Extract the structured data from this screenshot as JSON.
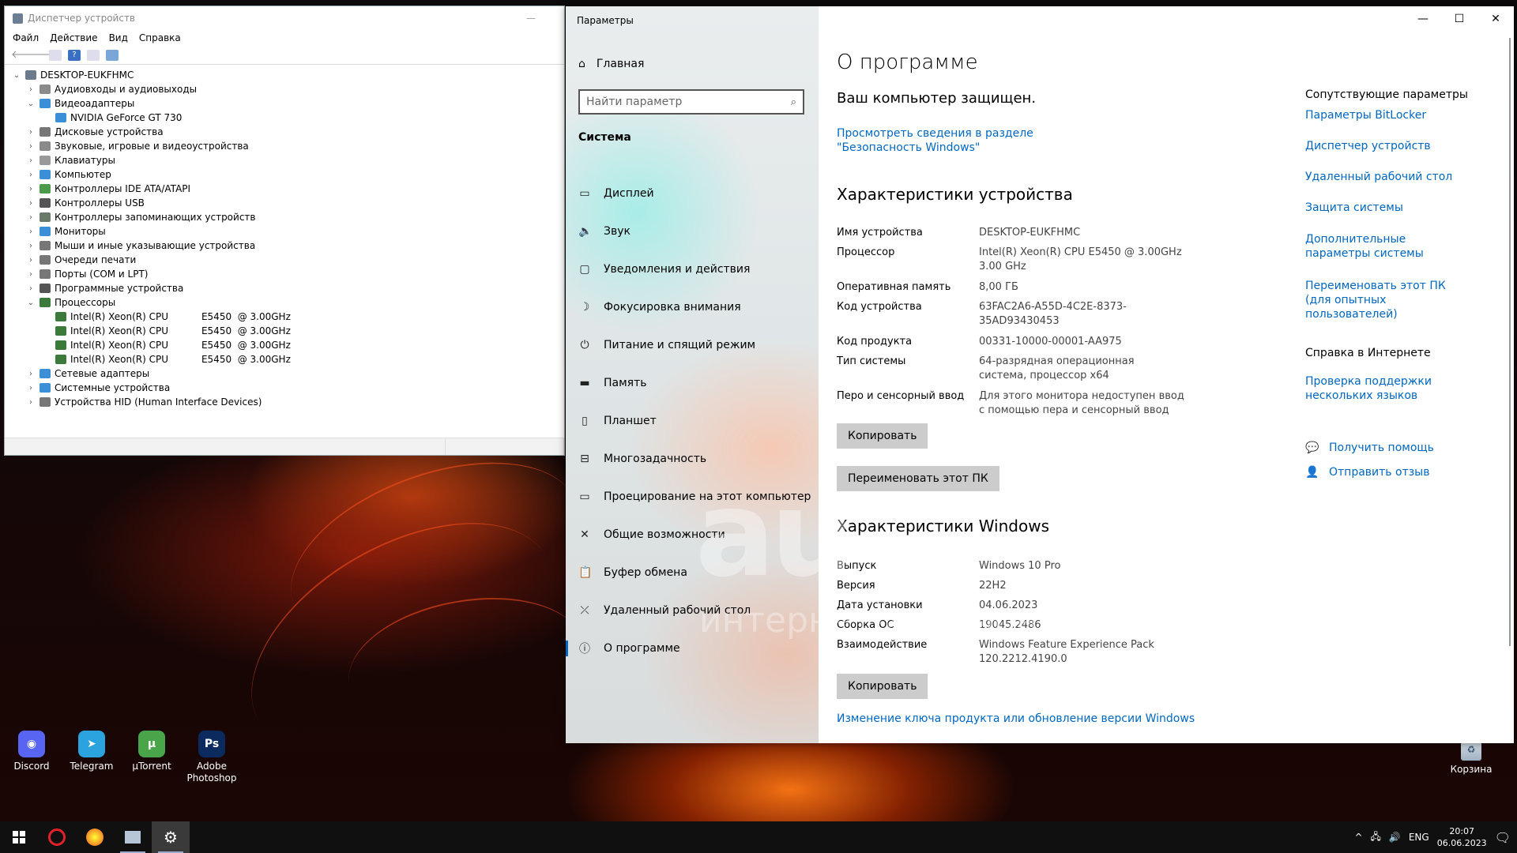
{
  "device_manager": {
    "title": "Диспетчер устройств",
    "menu": [
      "Файл",
      "Действие",
      "Вид",
      "Справка"
    ],
    "tree": [
      {
        "level": 0,
        "exp": "v",
        "label": "DESKTOP-EUKFHMC",
        "color": "#6b7b8c"
      },
      {
        "level": 1,
        "exp": ">",
        "label": "Аудиовходы и аудиовыходы",
        "color": "#8a8a8a"
      },
      {
        "level": 1,
        "exp": "v",
        "label": "Видеоадаптеры",
        "color": "#3b8fd6"
      },
      {
        "level": 2,
        "exp": "",
        "label": "NVIDIA GeForce GT 730",
        "color": "#3b8fd6"
      },
      {
        "level": 1,
        "exp": ">",
        "label": "Дисковые устройства",
        "color": "#777"
      },
      {
        "level": 1,
        "exp": ">",
        "label": "Звуковые, игровые и видеоустройства",
        "color": "#8a8a8a"
      },
      {
        "level": 1,
        "exp": ">",
        "label": "Клавиатуры",
        "color": "#999"
      },
      {
        "level": 1,
        "exp": ">",
        "label": "Компьютер",
        "color": "#3b8fd6"
      },
      {
        "level": 1,
        "exp": ">",
        "label": "Контроллеры IDE ATA/ATAPI",
        "color": "#4a9a4a"
      },
      {
        "level": 1,
        "exp": ">",
        "label": "Контроллеры USB",
        "color": "#555"
      },
      {
        "level": 1,
        "exp": ">",
        "label": "Контроллеры запоминающих устройств",
        "color": "#6a7a6a"
      },
      {
        "level": 1,
        "exp": ">",
        "label": "Мониторы",
        "color": "#3b8fd6"
      },
      {
        "level": 1,
        "exp": ">",
        "label": "Мыши и иные указывающие устройства",
        "color": "#777"
      },
      {
        "level": 1,
        "exp": ">",
        "label": "Очереди печати",
        "color": "#777"
      },
      {
        "level": 1,
        "exp": ">",
        "label": "Порты (COM и LPT)",
        "color": "#777"
      },
      {
        "level": 1,
        "exp": ">",
        "label": "Программные устройства",
        "color": "#555"
      },
      {
        "level": 1,
        "exp": "v",
        "label": "Процессоры",
        "color": "#3c7a3c"
      },
      {
        "level": 2,
        "exp": "",
        "label": "Intel(R) Xeon(R) CPU           E5450  @ 3.00GHz",
        "color": "#3c7a3c"
      },
      {
        "level": 2,
        "exp": "",
        "label": "Intel(R) Xeon(R) CPU           E5450  @ 3.00GHz",
        "color": "#3c7a3c"
      },
      {
        "level": 2,
        "exp": "",
        "label": "Intel(R) Xeon(R) CPU           E5450  @ 3.00GHz",
        "color": "#3c7a3c"
      },
      {
        "level": 2,
        "exp": "",
        "label": "Intel(R) Xeon(R) CPU           E5450  @ 3.00GHz",
        "color": "#3c7a3c"
      },
      {
        "level": 1,
        "exp": ">",
        "label": "Сетевые адаптеры",
        "color": "#3b8fd6"
      },
      {
        "level": 1,
        "exp": ">",
        "label": "Системные устройства",
        "color": "#3b8fd6"
      },
      {
        "level": 1,
        "exp": ">",
        "label": "Устройства HID (Human Interface Devices)",
        "color": "#777"
      }
    ]
  },
  "settings": {
    "window_title": "Параметры",
    "home_label": "Главная",
    "search_placeholder": "Найти параметр",
    "section": "Система",
    "nav": [
      {
        "icon": "▭",
        "label": "Дисплей",
        "name": "display"
      },
      {
        "icon": "🔈",
        "label": "Звук",
        "name": "sound"
      },
      {
        "icon": "▢",
        "label": "Уведомления и действия",
        "name": "notifications"
      },
      {
        "icon": "☽",
        "label": "Фокусировка внимания",
        "name": "focus"
      },
      {
        "icon": "⏻",
        "label": "Питание и спящий режим",
        "name": "power"
      },
      {
        "icon": "▬",
        "label": "Память",
        "name": "storage"
      },
      {
        "icon": "▯",
        "label": "Планшет",
        "name": "tablet"
      },
      {
        "icon": "⊟",
        "label": "Многозадачность",
        "name": "multitasking"
      },
      {
        "icon": "▭",
        "label": "Проецирование на этот компьютер",
        "name": "projecting"
      },
      {
        "icon": "✕",
        "label": "Общие возможности",
        "name": "shared"
      },
      {
        "icon": "📋",
        "label": "Буфер обмена",
        "name": "clipboard"
      },
      {
        "icon": "⤫",
        "label": "Удаленный рабочий стол",
        "name": "remote-desktop"
      },
      {
        "icon": "ⓘ",
        "label": "О программе",
        "name": "about",
        "active": true
      }
    ],
    "main": {
      "title": "О программе",
      "protected": "Ваш компьютер защищен.",
      "security_link": "Просмотреть сведения в разделе \"Безопасность Windows\"",
      "device_specs_title": "Характеристики устройства",
      "device_specs": [
        {
          "k": "Имя устройства",
          "v": "DESKTOP-EUKFHMC"
        },
        {
          "k": "Процессор",
          "v": "Intel(R) Xeon(R) CPU        E5450  @ 3.00GHz   3.00 GHz"
        },
        {
          "k": "Оперативная память",
          "v": "8,00 ГБ"
        },
        {
          "k": "Код устройства",
          "v": "63FAC2A6-A55D-4C2E-8373-35AD93430453"
        },
        {
          "k": "Код продукта",
          "v": "00331-10000-00001-AA975"
        },
        {
          "k": "Тип системы",
          "v": "64-разрядная операционная система, процессор x64"
        },
        {
          "k": "Перо и сенсорный ввод",
          "v": "Для этого монитора недоступен ввод с помощью пера и сенсорный ввод"
        }
      ],
      "copy_label": "Копировать",
      "rename_label": "Переименовать этот ПК",
      "windows_specs_title": "Характеристики Windows",
      "windows_specs": [
        {
          "k": "Выпуск",
          "v": "Windows 10 Pro"
        },
        {
          "k": "Версия",
          "v": "22H2"
        },
        {
          "k": "Дата установки",
          "v": "04.06.2023"
        },
        {
          "k": "Сборка ОС",
          "v": "19045.2486"
        },
        {
          "k": "Взаимодействие",
          "v": "Windows Feature Experience Pack 120.2212.4190.0"
        }
      ],
      "copy2_label": "Копировать",
      "change_key_link": "Изменение ключа продукта или обновление версии Windows"
    },
    "right": {
      "related_title": "Сопутствующие параметры",
      "related": [
        "Параметры BitLocker",
        "Диспетчер устройств",
        "Удаленный рабочий стол",
        "Защита системы",
        "Дополнительные параметры системы",
        "Переименовать этот ПК (для опытных пользователей)"
      ],
      "help_title": "Справка в Интернете",
      "help_link": "Проверка поддержки нескольких языков",
      "get_help": "Получить помощь",
      "feedback": "Отправить отзыв"
    }
  },
  "desktop": {
    "icons": [
      {
        "label": "Discord",
        "color": "#5865f2",
        "glyph": "◉"
      },
      {
        "label": "Telegram",
        "color": "#2aa3df",
        "glyph": "➤"
      },
      {
        "label": "µTorrent",
        "color": "#4aa54a",
        "glyph": "µ"
      },
      {
        "label": "Adobe Photoshop",
        "color": "#0b2a5e",
        "glyph": "Ps"
      }
    ],
    "recycle_label": "Корзина",
    "watermark": "au",
    "watermark_sub": "интернет-аукцион"
  },
  "taskbar": {
    "lang": "ENG",
    "time": "20:07",
    "date": "06.06.2023"
  }
}
